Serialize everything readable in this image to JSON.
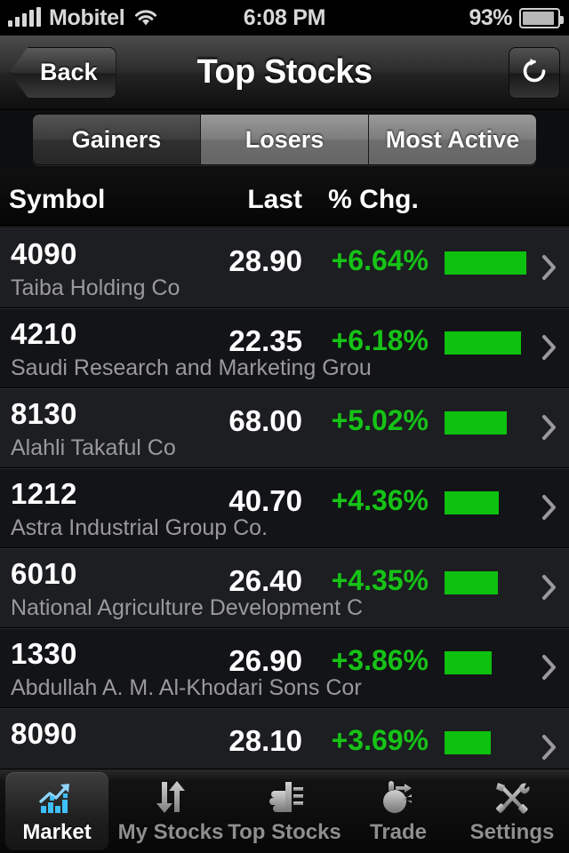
{
  "status_bar": {
    "carrier": "Mobitel",
    "time": "6:08 PM",
    "battery_pct": "93%",
    "signal_icon": "signal-bars-icon",
    "wifi_icon": "wifi-icon",
    "battery_icon": "battery-icon"
  },
  "nav_bar": {
    "back_label": "Back",
    "title": "Top Stocks",
    "refresh_icon": "refresh-icon"
  },
  "segmented_control": {
    "selected": "Gainers",
    "options": [
      {
        "label": "Gainers",
        "selected": true
      },
      {
        "label": "Losers",
        "selected": false
      },
      {
        "label": "Most Active",
        "selected": false
      }
    ]
  },
  "table": {
    "headers": {
      "symbol": "Symbol",
      "last": "Last",
      "change": "% Chg."
    },
    "rows": [
      {
        "symbol": "4090",
        "name": "Taiba Holding Co",
        "last": "28.90",
        "change": "+6.64%",
        "bar_pct": 100
      },
      {
        "symbol": "4210",
        "name": "Saudi Research and Marketing Grou",
        "last": "22.35",
        "change": "+6.18%",
        "bar_pct": 93
      },
      {
        "symbol": "8130",
        "name": "Alahli Takaful Co",
        "last": "68.00",
        "change": "+5.02%",
        "bar_pct": 76
      },
      {
        "symbol": "1212",
        "name": "Astra Industrial Group Co.",
        "last": "40.70",
        "change": "+4.36%",
        "bar_pct": 66
      },
      {
        "symbol": "6010",
        "name": "National Agriculture Development C",
        "last": "26.40",
        "change": "+4.35%",
        "bar_pct": 65
      },
      {
        "symbol": "1330",
        "name": "Abdullah A. M. Al-Khodari Sons Cor",
        "last": "26.90",
        "change": "+3.86%",
        "bar_pct": 58
      },
      {
        "symbol": "8090",
        "name": "",
        "last": "28.10",
        "change": "+3.69%",
        "bar_pct": 56
      }
    ]
  },
  "tab_bar": {
    "active": "Market",
    "tabs": [
      {
        "label": "Market",
        "icon": "chart-trend-icon",
        "active": true
      },
      {
        "label": "My Stocks",
        "icon": "up-down-arrows-icon",
        "active": false
      },
      {
        "label": "Top Stocks",
        "icon": "thumbs-up-icon",
        "active": false
      },
      {
        "label": "Trade",
        "icon": "hand-exchange-icon",
        "active": false
      },
      {
        "label": "Settings",
        "icon": "tools-icon",
        "active": false
      }
    ]
  },
  "colors": {
    "gain_green": "#16c316",
    "bar_green": "#0ec10e",
    "accent_blue": "#5ec2f5",
    "background": "#0d0e10"
  }
}
